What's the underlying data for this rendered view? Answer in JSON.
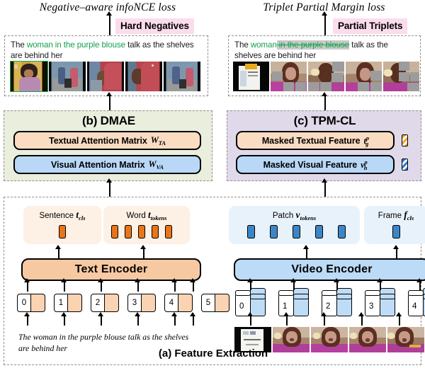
{
  "figure": {
    "caption": "(a) Feature Extraction"
  },
  "losses": {
    "left": "Negative–aware infoNCE loss",
    "right": "Triplet Partial Margin loss"
  },
  "badges": {
    "left": "Hard Negatives",
    "right": "Partial Triplets",
    "color": "#fbdcec"
  },
  "negatives_panel": {
    "name": "hard-negatives-panel",
    "caption_prefix": "The ",
    "caption_green": "woman in the purple blouse",
    "caption_suffix": " talk as the shelves are behind her",
    "selected_index": 0,
    "frame_count": 5
  },
  "triplets_panel": {
    "name": "partial-triplets-panel",
    "caption_prefix": "The ",
    "caption_green": "woman",
    "caption_struck": " in the purple blouse",
    "caption_suffix": " talk as the shelves are behind her",
    "frame_count": 5
  },
  "module_b": {
    "title": "(b) DMAE",
    "bg": "#e9eedd",
    "rows": [
      {
        "label": "Textual Attention Matrix",
        "symbol": "W",
        "sub": "TA",
        "color": "#fadcc3"
      },
      {
        "label": "Visual Attention Matrix",
        "symbol": "W",
        "sub": "VA",
        "color": "#b9d8f7"
      }
    ]
  },
  "module_c": {
    "title": "(c) TPM-CL",
    "bg": "#e0d9ea",
    "rows": [
      {
        "label": "Masked Textual Feature",
        "symbol": "t",
        "sub": "g",
        "sup": "p",
        "color": "#fadcc3",
        "token": "orange-striped-token"
      },
      {
        "label": "Masked Visual Feature",
        "symbol": "v",
        "sub": "h",
        "sup": "p",
        "color": "#b9d8f7",
        "token": "blue-striped-token"
      }
    ]
  },
  "text_branch": {
    "sentence_group": {
      "label": "Sentence",
      "symbol": "t",
      "sub": "cls",
      "token_count": 1
    },
    "word_group": {
      "label": "Word",
      "symbol": "t",
      "sub": "tokens",
      "token_count": 5
    },
    "encoder": "Text Encoder",
    "encoder_color": "#f7c9a3",
    "token_color": "#e8751a",
    "word_indices": [
      "0",
      "1",
      "2",
      "3",
      "4",
      "5"
    ],
    "source_sentence": "The woman in the purple blouse talk as the shelves are behind her"
  },
  "video_branch": {
    "patch_group": {
      "label": "Patch",
      "symbol": "v",
      "sub": "tokens",
      "token_count": 5
    },
    "frame_group": {
      "label": "Frame",
      "symbol": "f",
      "sub": "cls",
      "token_count": 1
    },
    "encoder": "Video Encoder",
    "encoder_color": "#bcdbf7",
    "token_color": "#3d86c6",
    "frame_indices": [
      "0",
      "1",
      "2",
      "3",
      "4"
    ],
    "frame_count": 5
  }
}
